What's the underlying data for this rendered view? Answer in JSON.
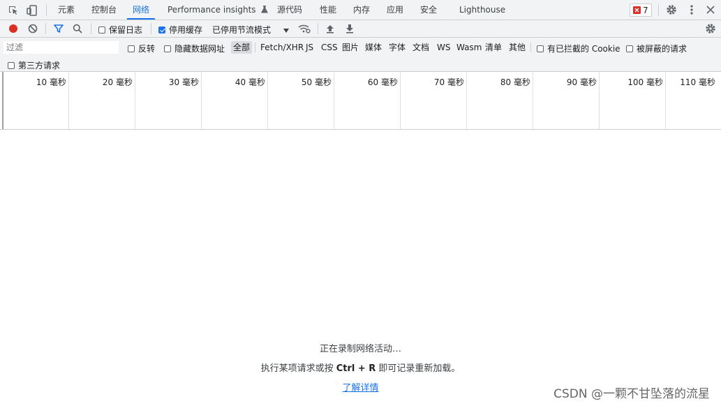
{
  "tabs": [
    {
      "label": "元素"
    },
    {
      "label": "控制台"
    },
    {
      "label": "网络"
    },
    {
      "label": "Performance insights"
    },
    {
      "label": "源代码"
    },
    {
      "label": "性能"
    },
    {
      "label": "内存"
    },
    {
      "label": "应用"
    },
    {
      "label": "安全"
    },
    {
      "label": "Lighthouse"
    }
  ],
  "active_tab": "网络",
  "issues_count": "7",
  "toolbar": {
    "preserve_log": "保留日志",
    "disable_cache": "停用缓存",
    "throttling": "已停用节流模式"
  },
  "filter": {
    "placeholder": "过滤",
    "invert": "反转",
    "hide_data_urls": "隐藏数据网址",
    "types": [
      "全部",
      "Fetch/XHR",
      "JS",
      "CSS",
      "图片",
      "媒体",
      "字体",
      "文档",
      "WS",
      "Wasm",
      "清单",
      "其他"
    ],
    "blocked_cookies": "有已拦截的 Cookie",
    "blocked_requests": "被屏蔽的请求",
    "third_party": "第三方请求"
  },
  "timeline_ticks": [
    "10 毫秒",
    "20 毫秒",
    "30 毫秒",
    "40 毫秒",
    "50 毫秒",
    "60 毫秒",
    "70 毫秒",
    "80 毫秒",
    "90 毫秒",
    "100 毫秒",
    "110 毫秒"
  ],
  "empty_state": {
    "recording": "正在录制网络活动…",
    "hint_before": "执行某项请求或按 ",
    "hint_keys": "Ctrl + R",
    "hint_after": " 即可记录重新加载。",
    "learn_more": "了解详情"
  },
  "watermark": "CSDN @一颗不甘坠落的流星",
  "colors": {
    "accent": "#1a73e8",
    "record": "#d93025",
    "toolbar_bg": "#f1f3f4"
  }
}
